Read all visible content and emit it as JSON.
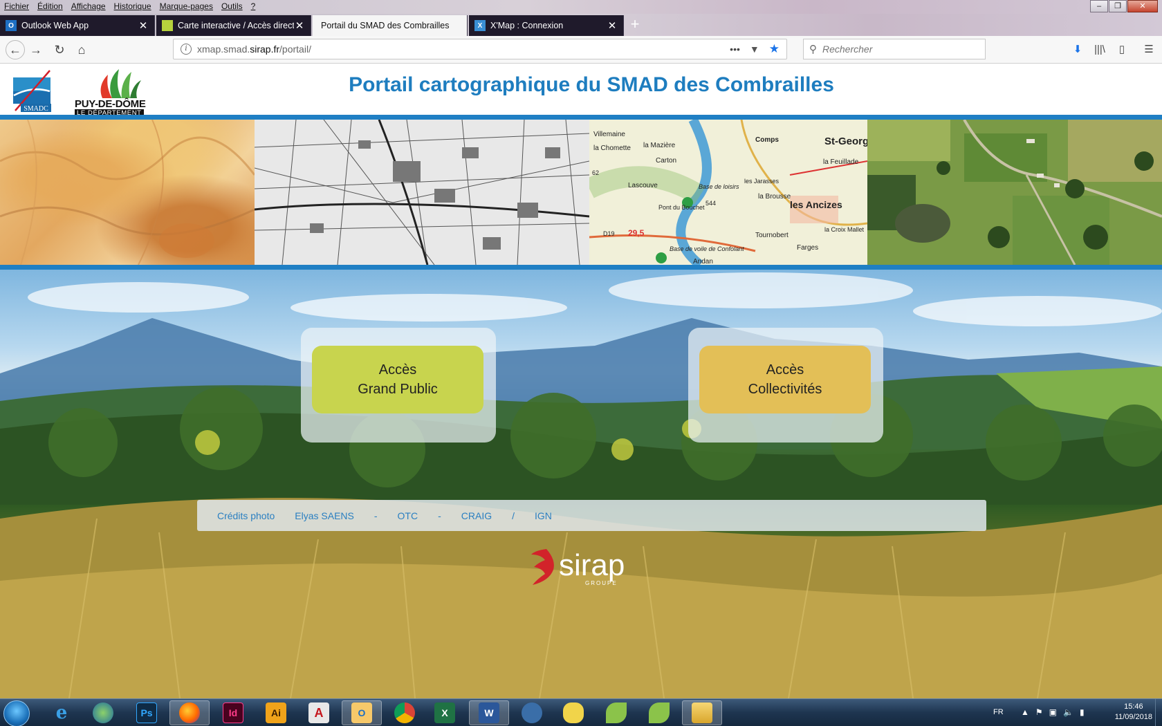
{
  "menubar": {
    "items": [
      "Fichier",
      "Édition",
      "Affichage",
      "Historique",
      "Marque-pages",
      "Outils",
      "?"
    ]
  },
  "tabs": [
    {
      "title": "Outlook Web App",
      "icon": "outlook-icon"
    },
    {
      "title": "Carte interactive / Accès direct",
      "icon": "map-icon"
    },
    {
      "title": "Portail du SMAD des Combrailles",
      "icon": "none",
      "active": true
    },
    {
      "title": "X'Map : Connexion",
      "icon": "xmap-icon"
    }
  ],
  "navbar": {
    "url_prefix": "xmap.smad.",
    "url_domain": "sirap.fr",
    "url_path": "/portail/",
    "search_placeholder": "Rechercher"
  },
  "header": {
    "title": "Portail cartographique du SMAD des Combrailles",
    "smadc_logo": "SMADC",
    "pdd_name": "PUY-DE-DÔME",
    "pdd_sub": "LE DÉPARTEMENT"
  },
  "topo_labels": [
    "Villemaine",
    "la Chomette",
    "la Mazière",
    "Carton",
    "Comps",
    "St-Georges-de-Mons",
    "la Feuillade",
    "Lascouve",
    "Base de loisirs",
    "les Jarasses",
    "la Brousse",
    "les Ancizes",
    "Pont du Bouchet",
    "Tournobert",
    "la Croix Mallet",
    "Farges",
    "Base de voile de Confolant",
    "Andan",
    "D19",
    "29,5",
    "62",
    "544"
  ],
  "access": {
    "public": {
      "line1": "Accès",
      "line2": "Grand Public"
    },
    "collectivites": {
      "line1": "Accès",
      "line2": "Collectivités"
    }
  },
  "credits": {
    "label": "Crédits photo",
    "items": [
      "Elyas SAENS",
      "-",
      "OTC",
      "-",
      "CRAIG",
      "/",
      "IGN"
    ]
  },
  "footer_logo": {
    "name": "sirap",
    "sub": "GROUPE"
  },
  "taskbar": {
    "apps": [
      "ie-icon",
      "globe-icon",
      "photoshop-icon",
      "firefox-icon",
      "indesign-icon",
      "illustrator-icon",
      "acrobat-icon",
      "outlook-icon",
      "chrome-icon",
      "excel-icon",
      "word-icon",
      "network-icon",
      "teapot-icon",
      "qgis-icon",
      "qgis-icon-2",
      "explorer-icon"
    ],
    "labels": {
      "ps": "Ps",
      "id": "Id",
      "ai": "Ai"
    },
    "lang": "FR",
    "time": "15:46",
    "date": "11/09/2018"
  },
  "colors": {
    "accent": "#1e7dbf",
    "public_button": "#c8d44e",
    "collect_button": "#e3bf57"
  }
}
